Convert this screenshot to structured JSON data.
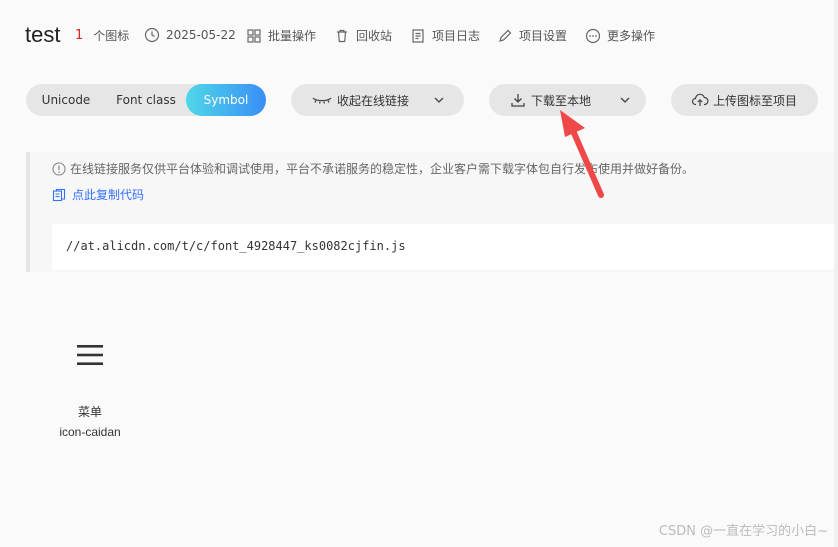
{
  "project": {
    "title": "test",
    "icon_count": "1",
    "icon_count_label": "个图标",
    "date": "2025-05-22",
    "batch_label": "批量操作",
    "trash_label": "回收站",
    "log_label": "项目日志",
    "settings_label": "项目设置",
    "more_label": "更多操作"
  },
  "tabs": {
    "unicode": "Unicode",
    "font_class": "Font class",
    "symbol": "Symbol",
    "active": "Symbol"
  },
  "actions": {
    "collapse_link": "收起在线链接",
    "download_local": "下载至本地",
    "upload_icons": "上传图标至项目"
  },
  "notice": {
    "text": "在线链接服务仅供平台体验和调试使用，平台不承诺服务的稳定性，企业客户需下载字体包自行发布使用并做好备份。",
    "copy_code": "点此复制代码",
    "code": "//at.alicdn.com/t/c/font_4928447_ks0082cjfin.js"
  },
  "icons": [
    {
      "name": "菜单",
      "code": "icon-caidan",
      "icon": "menu-icon"
    }
  ],
  "watermark": "CSDN @一直在学习的小白~",
  "colors": {
    "accent_start": "#4fd7e8",
    "accent_end": "#3a8ef6",
    "count_red": "#e02020",
    "link_blue": "#3370ff",
    "annotation_arrow": "#f04848"
  }
}
